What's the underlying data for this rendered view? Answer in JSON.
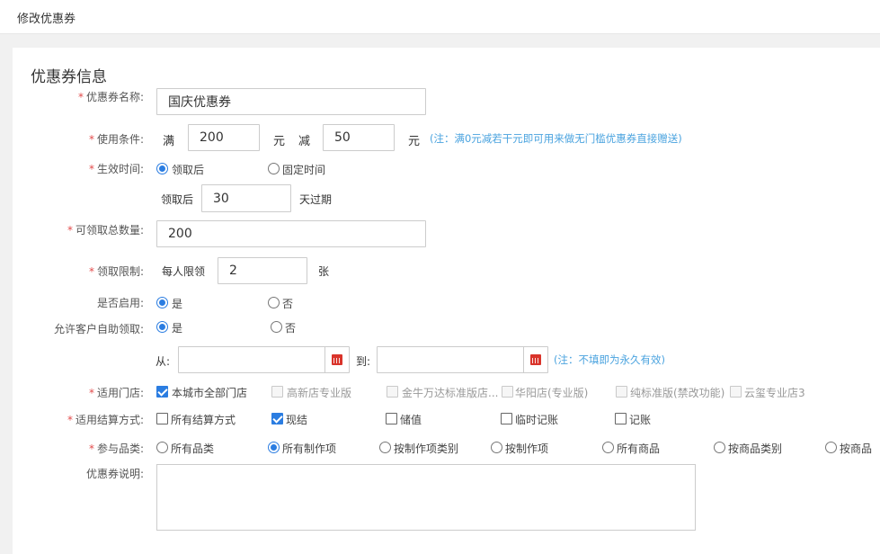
{
  "topbar": {
    "title": "修改优惠券"
  },
  "section_title": "优惠券信息",
  "labels": {
    "name": "优惠券名称:",
    "condition": "使用条件:",
    "effective": "生效时间:",
    "total": "可领取总数量:",
    "limit": "领取限制:",
    "enabled": "是否启用:",
    "self_claim": "允许客户自助领取:",
    "stores": "适用门店:",
    "settlement": "适用结算方式:",
    "category": "参与品类:",
    "desc": "优惠券说明:"
  },
  "required_mark": "*",
  "name_value": "国庆优惠券",
  "condition": {
    "full_label": "满",
    "full_value": "200",
    "unit1": "元",
    "minus_label": "减",
    "minus_value": "50",
    "unit2": "元",
    "note": "(注：满0元减若干元即可用来做无门槛优惠券直接赠送)"
  },
  "effective": {
    "options": [
      "领取后",
      "固定时间"
    ],
    "selected": 0,
    "after_label": "领取后",
    "days_value": "30",
    "days_suffix": "天过期"
  },
  "total_value": "200",
  "limit": {
    "prefix": "每人限领",
    "value": "2",
    "suffix": "张"
  },
  "enabled": {
    "options": [
      "是",
      "否"
    ],
    "selected": 0
  },
  "self_claim": {
    "options": [
      "是",
      "否"
    ],
    "selected": 0,
    "from_label": "从:",
    "to_label": "到:",
    "from_value": "",
    "to_value": "",
    "note": "(注：不填即为永久有效)"
  },
  "stores": [
    {
      "label": "本城市全部门店",
      "checked": true,
      "disabled": false
    },
    {
      "label": "高新店专业版",
      "checked": false,
      "disabled": true
    },
    {
      "label": "金牛万达标准版店...",
      "checked": false,
      "disabled": true
    },
    {
      "label": "华阳店(专业版)",
      "checked": false,
      "disabled": true
    },
    {
      "label": "纯标准版(禁改功能)",
      "checked": false,
      "disabled": true
    },
    {
      "label": "云玺专业店3",
      "checked": false,
      "disabled": true
    }
  ],
  "settlement": [
    {
      "label": "所有结算方式",
      "checked": false
    },
    {
      "label": "现结",
      "checked": true
    },
    {
      "label": "储值",
      "checked": false
    },
    {
      "label": "临时记账",
      "checked": false
    },
    {
      "label": "记账",
      "checked": false
    }
  ],
  "category": {
    "options": [
      "所有品类",
      "所有制作项",
      "按制作项类别",
      "按制作项",
      "所有商品",
      "按商品类别",
      "按商品"
    ],
    "selected": 1
  },
  "desc_value": "",
  "colors": {
    "accent": "#2b7de1",
    "required": "#e24b4b",
    "note": "#4aa3df",
    "calendar": "#d9342b"
  },
  "icons": {
    "calendar": "calendar-icon"
  }
}
